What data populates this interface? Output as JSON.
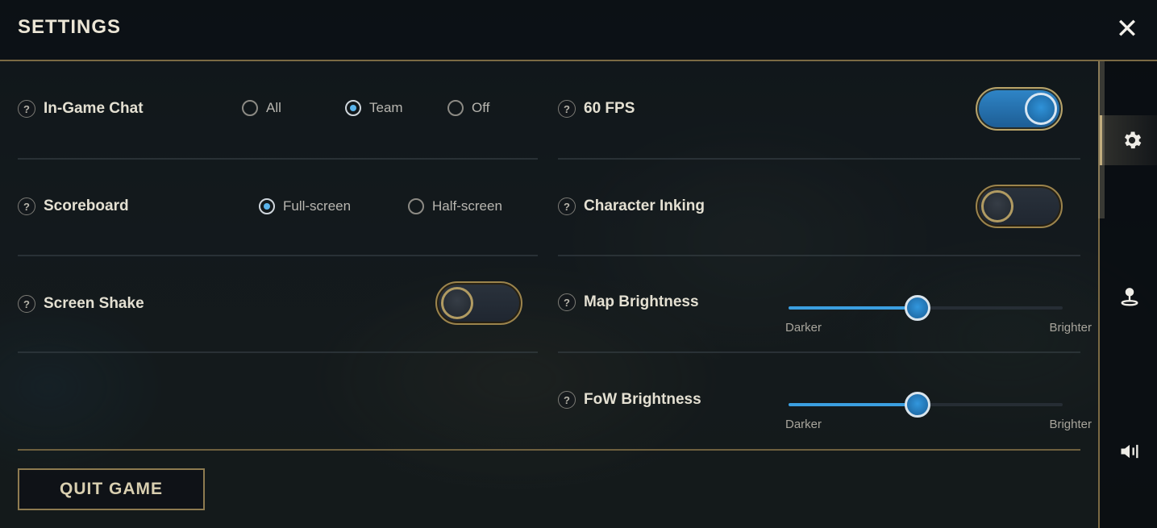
{
  "header": {
    "title": "SETTINGS",
    "close_icon": "close-icon"
  },
  "settings": {
    "chat": {
      "label": "In-Game Chat",
      "options": [
        "All",
        "Team",
        "Off"
      ],
      "selected": "Team"
    },
    "fps": {
      "label": "60 FPS",
      "enabled": true
    },
    "scoreboard": {
      "label": "Scoreboard",
      "options": [
        "Full-screen",
        "Half-screen"
      ],
      "selected": "Full-screen"
    },
    "inking": {
      "label": "Character Inking",
      "enabled": false
    },
    "shake": {
      "label": "Screen Shake",
      "enabled": false
    },
    "map_brightness": {
      "label": "Map Brightness",
      "value_fraction": 0.47,
      "low_label": "Darker",
      "high_label": "Brighter"
    },
    "fow_brightness": {
      "label": "FoW Brightness",
      "value_fraction": 0.47,
      "low_label": "Darker",
      "high_label": "Brighter"
    }
  },
  "help_symbol": "?",
  "footer": {
    "quit_label": "QUIT GAME"
  },
  "sidebar": {
    "tabs": [
      {
        "icon": "gear-icon",
        "active": true
      },
      {
        "icon": "map-pin-icon",
        "active": false
      },
      {
        "icon": "speaker-icon",
        "active": false
      }
    ]
  },
  "colors": {
    "accent_blue": "#3b9fe0",
    "gold_border": "#9c844c",
    "text_light": "#e4e0d2"
  }
}
